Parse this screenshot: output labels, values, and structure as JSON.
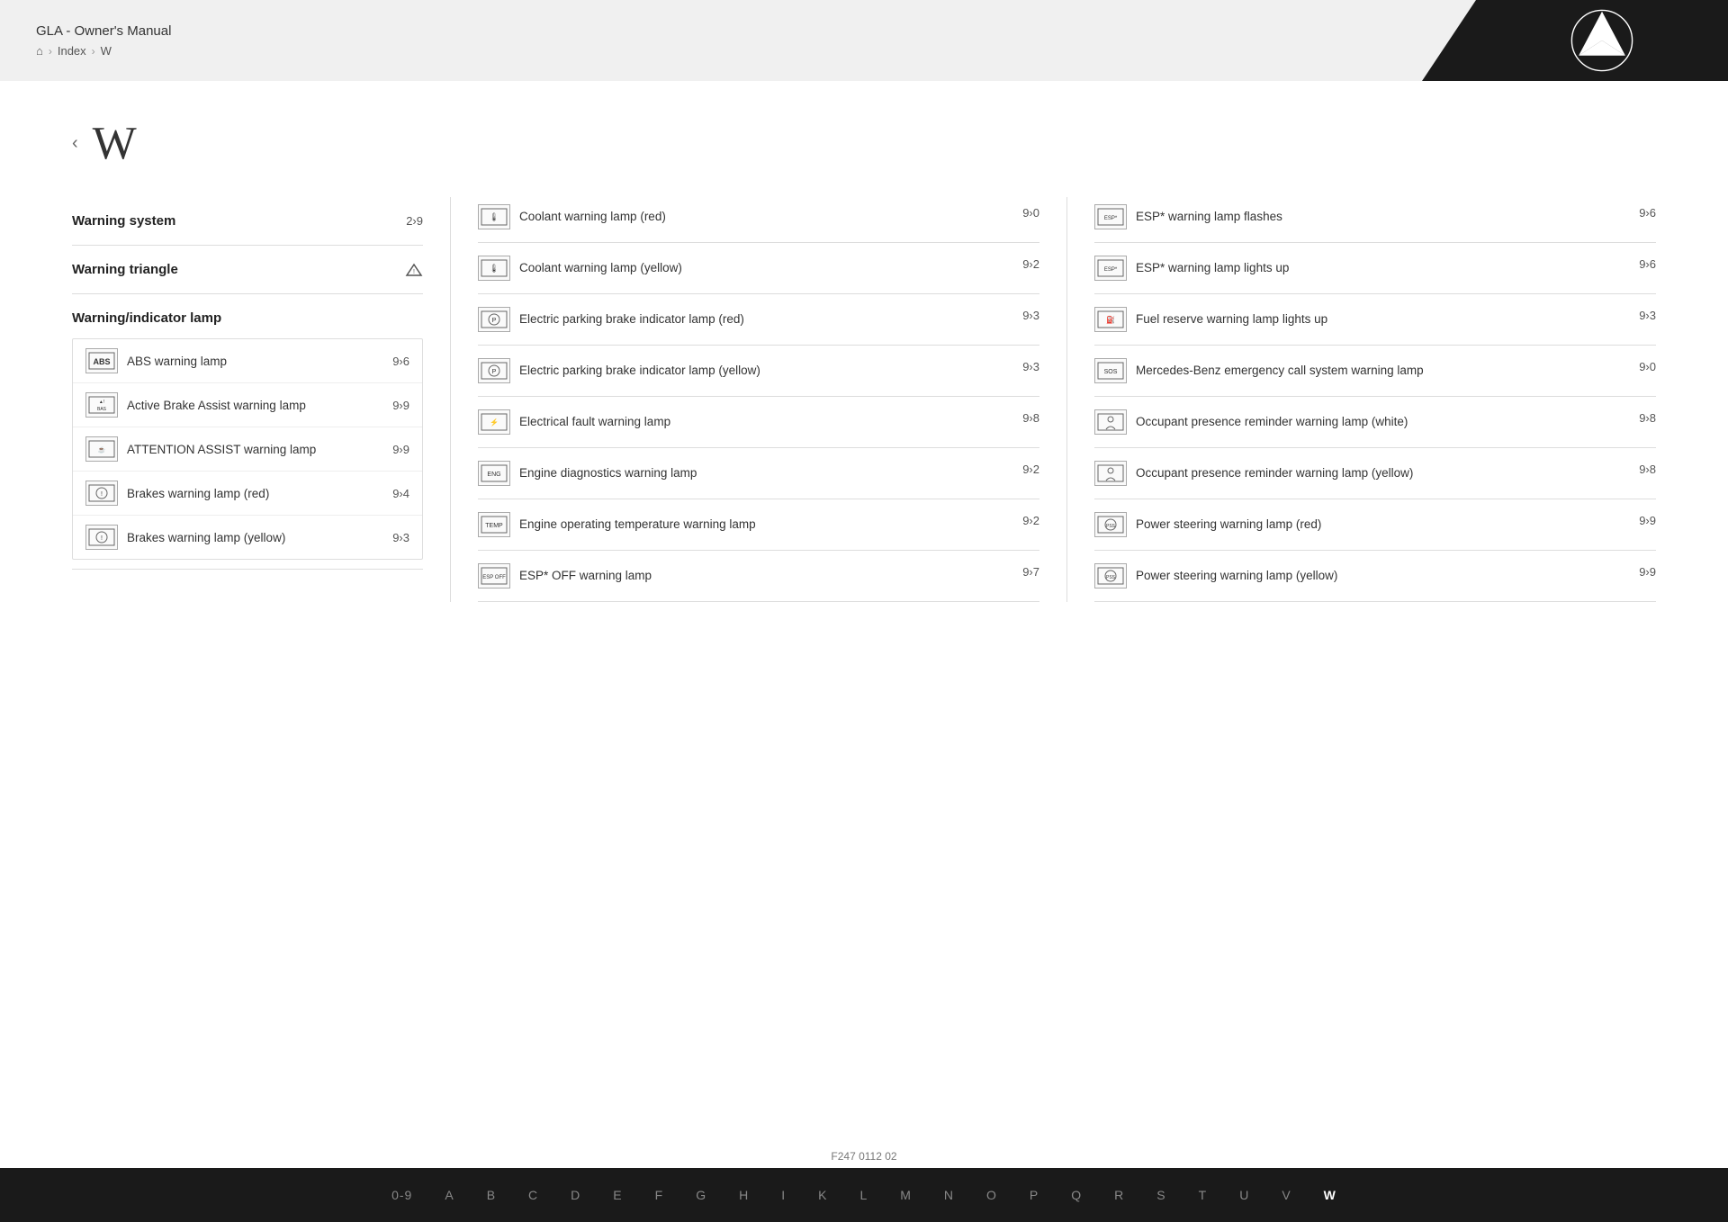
{
  "header": {
    "title": "GLA - Owner's Manual",
    "breadcrumb": [
      "🏠",
      "Index",
      "W"
    ]
  },
  "page": {
    "letter": "W",
    "doc_id": "F247 0112 02"
  },
  "left_column": {
    "top_items": [
      {
        "label": "Warning system",
        "ref": "2›9"
      },
      {
        "label": "Warning triangle",
        "ref": "›"
      },
      {
        "label": "Warning/indicator lamp",
        "ref": ""
      }
    ],
    "sub_items": [
      {
        "icon": "abs",
        "label": "ABS warning lamp",
        "ref": "9›6"
      },
      {
        "icon": "brake-assist",
        "label": "Active Brake Assist warning lamp",
        "ref": "9›9"
      },
      {
        "icon": "attention-assist",
        "label": "ATTENTION ASSIST warning lamp",
        "ref": "9›9"
      },
      {
        "icon": "brakes-red",
        "label": "Brakes warning lamp (red)",
        "ref": "9›4"
      },
      {
        "icon": "brakes-yellow",
        "label": "Brakes warning lamp (yellow)",
        "ref": "9›3"
      }
    ]
  },
  "middle_column": {
    "items": [
      {
        "icon": "coolant",
        "label": "Coolant warning lamp (red)",
        "ref": "9›0"
      },
      {
        "icon": "coolant",
        "label": "Coolant warning lamp (yellow)",
        "ref": "9›2"
      },
      {
        "icon": "parking-brake",
        "label": "Electric parking brake indicator lamp (red)",
        "ref": "9›3"
      },
      {
        "icon": "parking-brake",
        "label": "Electric parking brake indicator lamp (yellow)",
        "ref": "9›3"
      },
      {
        "icon": "elec-fault",
        "label": "Electrical fault warning lamp",
        "ref": "9›8"
      },
      {
        "icon": "engine-diag",
        "label": "Engine diagnostics warning lamp",
        "ref": "9›2"
      },
      {
        "icon": "engine-temp",
        "label": "Engine operating temperature warning lamp",
        "ref": "9›2"
      },
      {
        "icon": "esp-off",
        "label": "ESP* OFF warning lamp",
        "ref": "9›7"
      }
    ]
  },
  "right_column": {
    "items": [
      {
        "icon": "esp",
        "label": "ESP* warning lamp flashes",
        "ref": "9›6"
      },
      {
        "icon": "esp",
        "label": "ESP* warning lamp lights up",
        "ref": "9›6"
      },
      {
        "icon": "fuel",
        "label": "Fuel reserve warning lamp lights up",
        "ref": "9›3"
      },
      {
        "icon": "emergency",
        "label": "Mercedes-Benz emergency call system warning lamp",
        "ref": "9›0"
      },
      {
        "icon": "occupant-white",
        "label": "Occupant presence reminder warning lamp (white)",
        "ref": "9›8"
      },
      {
        "icon": "occupant-yellow",
        "label": "Occupant presence reminder warning lamp (yellow)",
        "ref": "9›8"
      },
      {
        "icon": "power-steering",
        "label": "Power steering warning lamp (red)",
        "ref": "9›9"
      },
      {
        "icon": "power-steering",
        "label": "Power steering warning lamp (yellow)",
        "ref": "9›9"
      }
    ]
  },
  "footer": {
    "letters": [
      "0-9",
      "A",
      "B",
      "C",
      "D",
      "E",
      "F",
      "G",
      "H",
      "I",
      "K",
      "L",
      "M",
      "N",
      "O",
      "P",
      "Q",
      "R",
      "S",
      "T",
      "U",
      "V",
      "W"
    ],
    "active": "W"
  }
}
